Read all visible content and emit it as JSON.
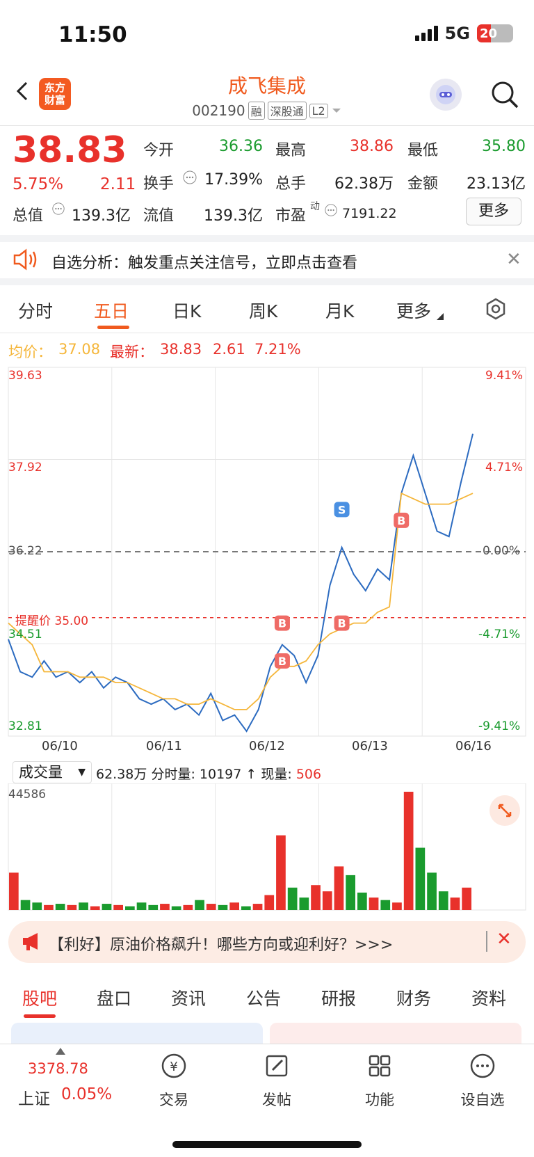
{
  "status": {
    "time": "11:50",
    "network": "5G",
    "battery": "20"
  },
  "header": {
    "logo_line1": "东方",
    "logo_line2": "财富",
    "title": "成飞集成",
    "code": "002190",
    "tags": [
      "融",
      "深股通",
      "L2"
    ]
  },
  "quote": {
    "price": "38.83",
    "change_pct": "5.75%",
    "change": "2.11",
    "rows": [
      [
        {
          "label": "今开",
          "value": "36.36",
          "color": "green"
        },
        {
          "label": "最高",
          "value": "38.86",
          "color": "red"
        },
        {
          "label": "最低",
          "value": "35.80",
          "color": "green"
        }
      ],
      [
        {
          "label": "换手",
          "value": "17.39%",
          "color": "dark"
        },
        {
          "label": "总手",
          "value": "62.38万",
          "color": "dark"
        },
        {
          "label": "金额",
          "value": "23.13亿",
          "color": "dark"
        }
      ],
      [
        {
          "label": "总值",
          "value": "139.3亿",
          "color": "dark"
        },
        {
          "label": "流值",
          "value": "139.3亿",
          "color": "dark"
        },
        {
          "label": "市盈",
          "value": "7191.22",
          "color": "dark",
          "sup": "动"
        }
      ]
    ],
    "more": "更多"
  },
  "alert": {
    "text": "自选分析：触发重点关注信号，立即点击查看"
  },
  "chart_tabs": [
    "分时",
    "五日",
    "日K",
    "周K",
    "月K",
    "更多"
  ],
  "active_tab": "五日",
  "legend": {
    "avg_label": "均价：",
    "avg": "37.08",
    "latest_label": "最新：",
    "latest": "38.83",
    "change": "2.61",
    "pct": "7.21%"
  },
  "chart_data": {
    "type": "line",
    "x_labels": [
      "06/10",
      "06/11",
      "06/12",
      "06/13",
      "06/16"
    ],
    "y_ticks": [
      "39.63",
      "37.92",
      "36.22",
      "34.51",
      "32.81"
    ],
    "y_pct_ticks": [
      "9.41%",
      "4.71%",
      "0.00%",
      "-4.71%",
      "-9.41%"
    ],
    "ylim": [
      32.81,
      39.63
    ],
    "base": 36.22,
    "alert_line": {
      "label": "提醒价 35.00",
      "value": 35.0
    },
    "series": [
      {
        "name": "价格",
        "color": "#2c6bc0",
        "values": [
          34.6,
          34.0,
          33.9,
          34.2,
          33.9,
          34.0,
          33.8,
          34.0,
          33.7,
          33.9,
          33.8,
          33.5,
          33.4,
          33.5,
          33.3,
          33.4,
          33.2,
          33.6,
          33.1,
          33.2,
          32.9,
          33.3,
          34.1,
          34.5,
          34.3,
          33.8,
          34.3,
          35.6,
          36.3,
          35.8,
          35.5,
          35.9,
          35.7,
          37.3,
          38.0,
          37.3,
          36.6,
          36.5,
          37.5,
          38.4
        ]
      },
      {
        "name": "均价",
        "color": "#f5b63a",
        "values": [
          34.9,
          34.7,
          34.5,
          34.0,
          34.0,
          34.0,
          33.9,
          33.9,
          33.9,
          33.8,
          33.8,
          33.7,
          33.6,
          33.5,
          33.5,
          33.4,
          33.4,
          33.5,
          33.4,
          33.3,
          33.3,
          33.5,
          33.9,
          34.1,
          34.1,
          34.2,
          34.5,
          34.7,
          34.8,
          34.9,
          34.9,
          35.1,
          35.2,
          37.3,
          37.2,
          37.1,
          37.1,
          37.1,
          37.2,
          37.3
        ]
      }
    ],
    "markers": [
      {
        "label": "S",
        "color": "#4a90e2",
        "idx": 28,
        "value": 37.0
      },
      {
        "label": "B",
        "color": "#ef6b66",
        "idx": 23,
        "value": 34.9
      },
      {
        "label": "B",
        "color": "#ef6b66",
        "idx": 23,
        "value": 34.2
      },
      {
        "label": "B",
        "color": "#ef6b66",
        "idx": 28,
        "value": 34.9
      },
      {
        "label": "B",
        "color": "#ef6b66",
        "idx": 33,
        "value": 36.8
      }
    ],
    "volume_max": "44586",
    "volumes": [
      30,
      8,
      6,
      4,
      5,
      4,
      6,
      3,
      5,
      4,
      3,
      6,
      4,
      5,
      3,
      4,
      8,
      5,
      4,
      6,
      3,
      5,
      12,
      60,
      18,
      10,
      20,
      15,
      35,
      28,
      14,
      10,
      8,
      6,
      95,
      50,
      30,
      15,
      10,
      18
    ]
  },
  "volume_bar": {
    "select": "成交量",
    "total": "62.38万",
    "fen_label": "分时量:",
    "fen": "10197",
    "now_label": "现量:",
    "now": "506"
  },
  "news": {
    "text": "【利好】原油价格飙升！哪些方向或迎利好？>>>"
  },
  "bottom_tabs": [
    "股吧",
    "盘口",
    "资讯",
    "公告",
    "研报",
    "财务",
    "资料"
  ],
  "bottom_nav": {
    "index_value": "3378.78",
    "index_name": "上证",
    "index_pct": "0.05%",
    "items": [
      "交易",
      "发帖",
      "功能",
      "设自选"
    ]
  }
}
